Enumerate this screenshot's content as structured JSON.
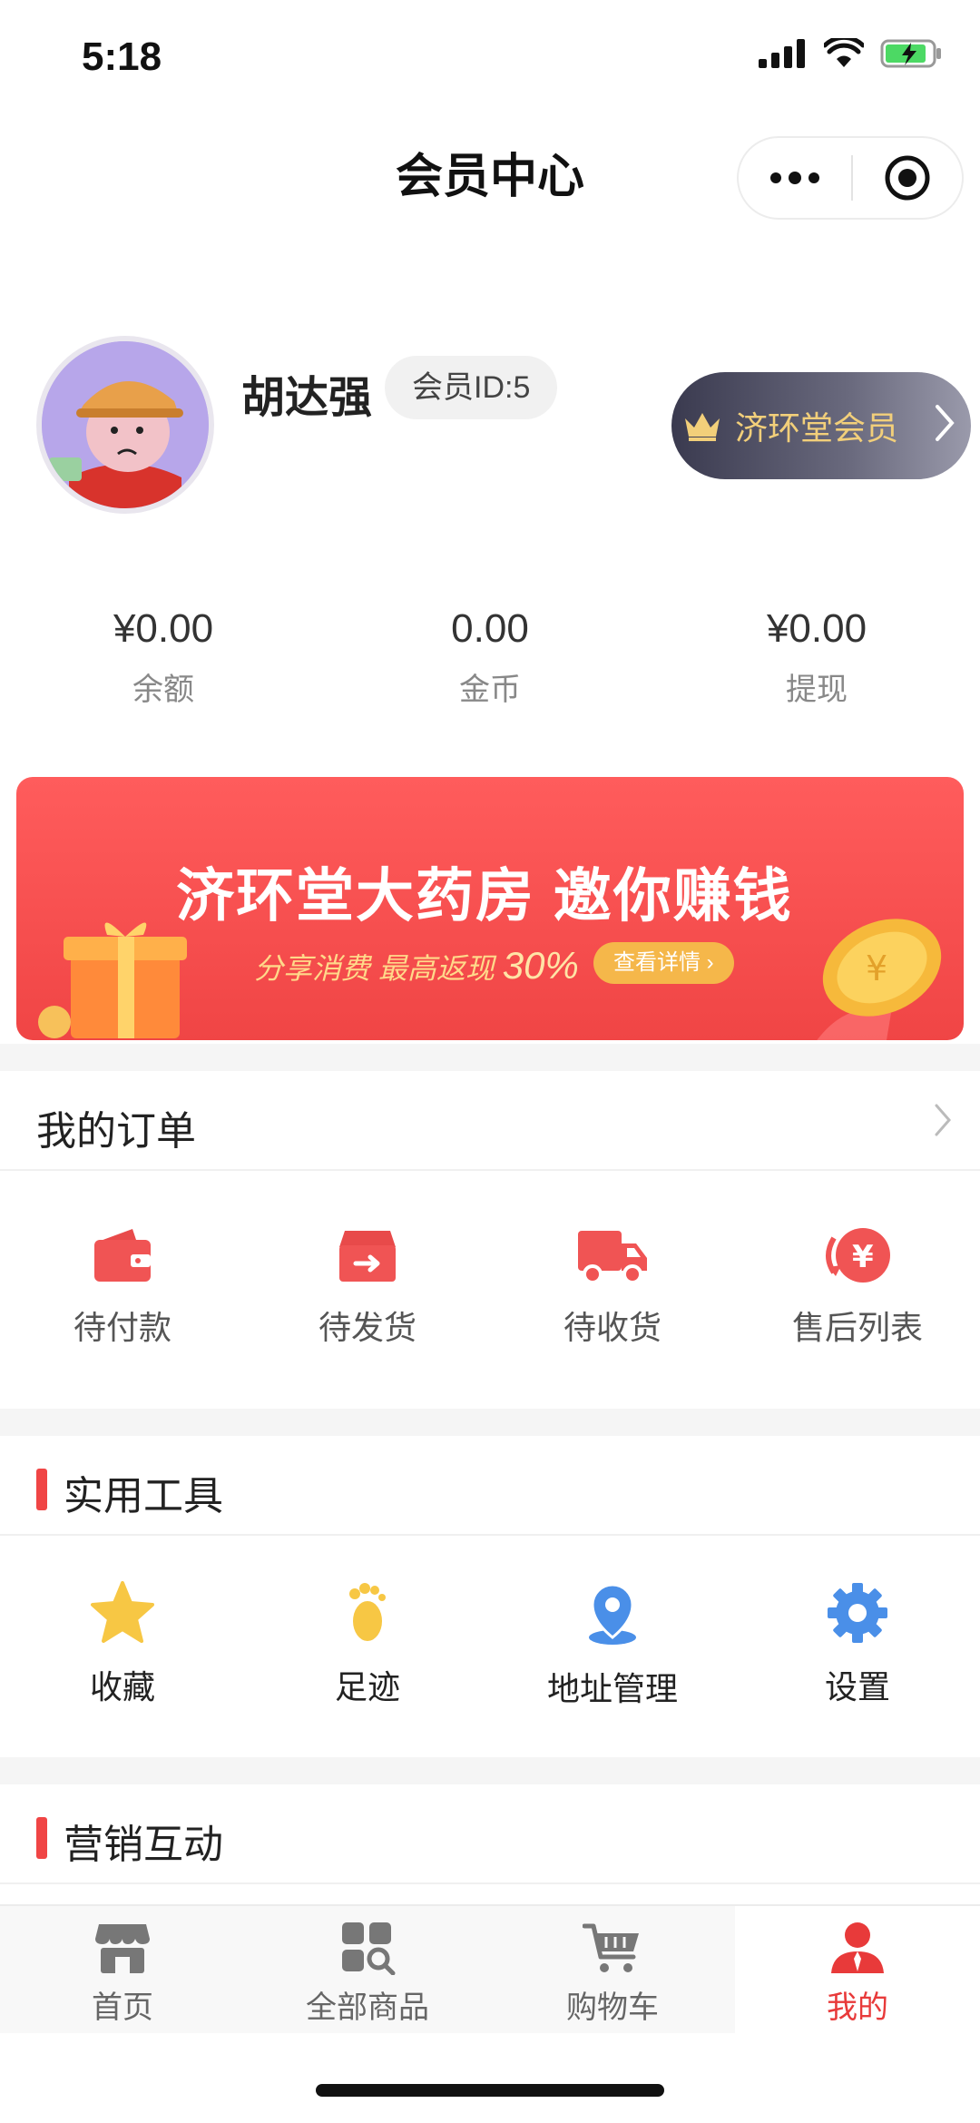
{
  "status": {
    "time": "5:18"
  },
  "nav": {
    "title": "会员中心"
  },
  "profile": {
    "name": "胡达强",
    "member_id": "会员ID:5",
    "vip_label": "济环堂会员"
  },
  "stats": [
    {
      "value": "¥0.00",
      "label": "余额"
    },
    {
      "value": "0.00",
      "label": "金币"
    },
    {
      "value": "¥0.00",
      "label": "提现"
    }
  ],
  "banner": {
    "headline": "济环堂大药房 邀你赚钱",
    "subtitle": "分享消费 最高返现",
    "percent": "30%",
    "button": "查看详情 ›"
  },
  "orders": {
    "title": "我的订单",
    "items": [
      {
        "label": "待付款",
        "icon": "wallet-icon"
      },
      {
        "label": "待发货",
        "icon": "ship-box-icon"
      },
      {
        "label": "待收货",
        "icon": "truck-icon"
      },
      {
        "label": "售后列表",
        "icon": "refund-icon"
      }
    ]
  },
  "tools": {
    "title": "实用工具",
    "items": [
      {
        "label": "收藏",
        "icon": "star-icon"
      },
      {
        "label": "足迹",
        "icon": "footprint-icon"
      },
      {
        "label": "地址管理",
        "icon": "location-pin-icon"
      },
      {
        "label": "设置",
        "icon": "gear-icon"
      }
    ]
  },
  "marketing": {
    "title": "营销互动"
  },
  "tabbar": {
    "items": [
      {
        "label": "首页",
        "icon": "store-icon"
      },
      {
        "label": "全部商品",
        "icon": "grid-search-icon"
      },
      {
        "label": "购物车",
        "icon": "cart-icon"
      },
      {
        "label": "我的",
        "icon": "user-icon"
      }
    ],
    "active_index": 3
  },
  "colors": {
    "accent": "#f04545",
    "gold": "#f2cf7a",
    "icon_blue": "#4a8fe8",
    "icon_yellow": "#f7c744"
  }
}
